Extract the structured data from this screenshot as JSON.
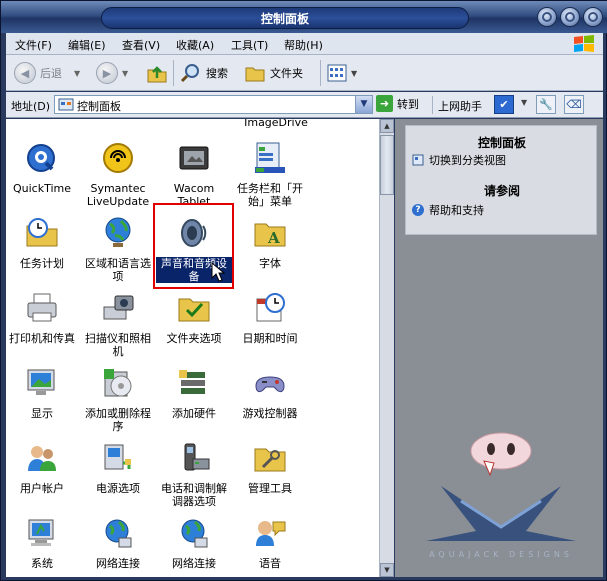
{
  "window": {
    "title": "控制面板"
  },
  "menu": {
    "items": [
      "文件(F)",
      "编辑(E)",
      "查看(V)",
      "收藏(A)",
      "工具(T)",
      "帮助(H)"
    ]
  },
  "toolbar": {
    "back": "后退",
    "search": "搜索",
    "folders": "文件夹"
  },
  "address": {
    "label": "地址(D)",
    "value": "控制面板",
    "go": "转到",
    "online_helper": "上网助手"
  },
  "partial_item": {
    "label": "ImageDrive"
  },
  "items": [
    {
      "label": "QuickTime",
      "icon": "quicktime-icon"
    },
    {
      "label": "Symantec LiveUpdate",
      "icon": "liveupdate-icon"
    },
    {
      "label": "Wacom Tablet",
      "icon": "tablet-icon"
    },
    {
      "label": "任务栏和「开始」菜单",
      "icon": "taskbar-icon"
    },
    {
      "label": "任务计划",
      "icon": "scheduled-tasks-icon"
    },
    {
      "label": "区域和语言选项",
      "icon": "globe-icon"
    },
    {
      "label": "声音和音频设备",
      "icon": "speaker-icon",
      "selected": true
    },
    {
      "label": "字体",
      "icon": "fonts-folder-icon"
    },
    {
      "label": "打印机和传真",
      "icon": "printer-icon"
    },
    {
      "label": "扫描仪和照相机",
      "icon": "scanner-icon"
    },
    {
      "label": "文件夹选项",
      "icon": "folder-options-icon"
    },
    {
      "label": "日期和时间",
      "icon": "clock-icon"
    },
    {
      "label": "显示",
      "icon": "display-icon"
    },
    {
      "label": "添加或删除程序",
      "icon": "add-remove-icon"
    },
    {
      "label": "添加硬件",
      "icon": "hardware-icon"
    },
    {
      "label": "游戏控制器",
      "icon": "gamepad-icon"
    },
    {
      "label": "用户帐户",
      "icon": "users-icon"
    },
    {
      "label": "电源选项",
      "icon": "power-icon"
    },
    {
      "label": "电话和调制解调器选项",
      "icon": "phone-modem-icon"
    },
    {
      "label": "管理工具",
      "icon": "admin-tools-icon"
    },
    {
      "label": "系统",
      "icon": "system-icon"
    },
    {
      "label": "网络连接",
      "icon": "network-icon"
    },
    {
      "label": "网络连接",
      "icon": "network-icon"
    },
    {
      "label": "语音",
      "icon": "speech-icon"
    }
  ],
  "side": {
    "section1_title": "控制面板",
    "switch_link": "切换到分类视图",
    "section2_title": "请参阅",
    "help_link": "帮助和支持"
  },
  "branding": {
    "text": "AQUAJACK DESIGNS"
  }
}
